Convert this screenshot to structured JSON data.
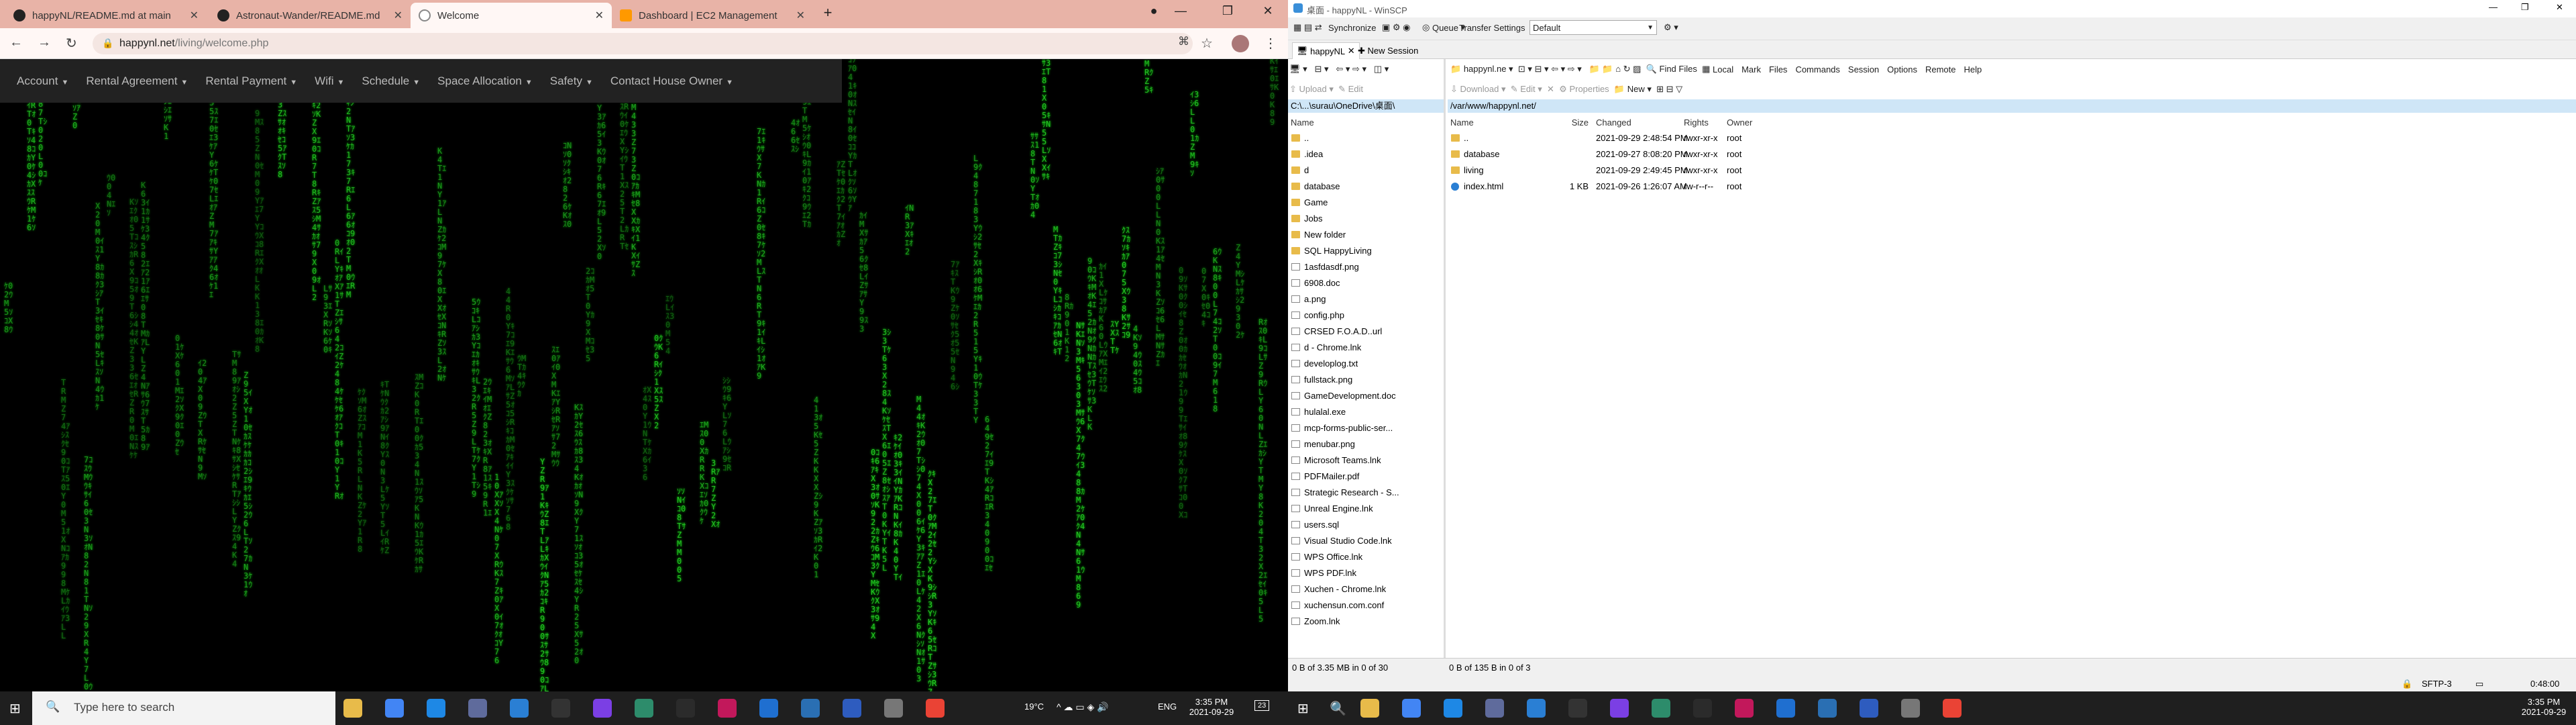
{
  "browser": {
    "tabs": [
      {
        "title": "happyNL/README.md at main"
      },
      {
        "title": "Astronaut-Wander/README.md"
      },
      {
        "title": "Welcome"
      },
      {
        "title": "Dashboard | EC2 Management"
      }
    ],
    "url_host": "happynl.net",
    "url_path": "/living/welcome.php",
    "nav": [
      {
        "label": "Account"
      },
      {
        "label": "Rental Agreement"
      },
      {
        "label": "Rental Payment"
      },
      {
        "label": "Wifi"
      },
      {
        "label": "Schedule"
      },
      {
        "label": "Space Allocation"
      },
      {
        "label": "Safety"
      },
      {
        "label": "Contact House Owner"
      }
    ]
  },
  "winscp": {
    "window_title": "happyNL - WinSCP",
    "title_prefix": "桌面",
    "toolbar1": {
      "synchronize": "Synchronize",
      "queue": "Queue",
      "transfer_settings": "Transfer Settings",
      "transfer_value": "Default"
    },
    "session_tab": "happyNL",
    "new_session": "New Session",
    "left": {
      "path": "C:\\...\\surau\\OneDrive\\桌面\\",
      "upload": "Upload",
      "edit": "Edit",
      "properties": "Properties",
      "new": "New",
      "col_name": "Name",
      "files": [
        {
          "name": "..",
          "type": "up"
        },
        {
          "name": ".idea",
          "type": "folder"
        },
        {
          "name": "d",
          "type": "folder"
        },
        {
          "name": "database",
          "type": "folder"
        },
        {
          "name": "Game",
          "type": "folder"
        },
        {
          "name": "Jobs",
          "type": "folder"
        },
        {
          "name": "New folder",
          "type": "folder"
        },
        {
          "name": "SQL HappyLiving",
          "type": "folder"
        },
        {
          "name": "1asfdasdf.png",
          "type": "file"
        },
        {
          "name": "6908.doc",
          "type": "file"
        },
        {
          "name": "a.png",
          "type": "file"
        },
        {
          "name": "config.php",
          "type": "file"
        },
        {
          "name": "CRSED F.O.A.D..url",
          "type": "file"
        },
        {
          "name": "d - Chrome.lnk",
          "type": "file"
        },
        {
          "name": "developlog.txt",
          "type": "file"
        },
        {
          "name": "fullstack.png",
          "type": "file"
        },
        {
          "name": "GameDevelopment.doc",
          "type": "file"
        },
        {
          "name": "hulalal.exe",
          "type": "file"
        },
        {
          "name": "mcp-forms-public-ser...",
          "type": "file"
        },
        {
          "name": "menubar.png",
          "type": "file"
        },
        {
          "name": "Microsoft Teams.lnk",
          "type": "file"
        },
        {
          "name": "PDFMailer.pdf",
          "type": "file"
        },
        {
          "name": "Strategic Research - S...",
          "type": "file"
        },
        {
          "name": "Unreal Engine.lnk",
          "type": "file"
        },
        {
          "name": "users.sql",
          "type": "file"
        },
        {
          "name": "Visual Studio Code.lnk",
          "type": "file"
        },
        {
          "name": "WPS Office.lnk",
          "type": "file"
        },
        {
          "name": "WPS PDF.lnk",
          "type": "file"
        },
        {
          "name": "Xuchen - Chrome.lnk",
          "type": "file"
        },
        {
          "name": "xuchensun.com.conf",
          "type": "file"
        },
        {
          "name": "Zoom.lnk",
          "type": "file"
        }
      ],
      "status": "0 B of 3.35 MB in 0 of 30"
    },
    "right": {
      "session_combo": "happynl.ne",
      "find_files": "Find Files",
      "menu": [
        "Local",
        "Mark",
        "Files",
        "Commands",
        "Session",
        "Options",
        "Remote",
        "Help"
      ],
      "download": "Download",
      "edit": "Edit",
      "properties": "Properties",
      "new": "New",
      "path": "/var/www/happynl.net/",
      "cols": {
        "name": "Name",
        "size": "Size",
        "changed": "Changed",
        "rights": "Rights",
        "owner": "Owner"
      },
      "files": [
        {
          "name": "..",
          "size": "",
          "changed": "2021-09-29 2:48:54 PM",
          "rights": "rwxr-xr-x",
          "owner": "root",
          "type": "up"
        },
        {
          "name": "database",
          "size": "",
          "changed": "2021-09-27 8:08:20 PM",
          "rights": "rwxr-xr-x",
          "owner": "root",
          "type": "folder"
        },
        {
          "name": "living",
          "size": "",
          "changed": "2021-09-29 2:49:45 PM",
          "rights": "rwxr-xr-x",
          "owner": "root",
          "type": "folder"
        },
        {
          "name": "index.html",
          "size": "1 KB",
          "changed": "2021-09-26 1:26:07 AM",
          "rights": "rw-r--r--",
          "owner": "root",
          "type": "html"
        }
      ],
      "status": "0 B of 135 B in 0 of 3"
    },
    "protocol": "SFTP-3",
    "elapsed": "0:48:00"
  },
  "taskbar": {
    "search_placeholder": "Type here to search",
    "weather": "19°C",
    "lang": "ENG",
    "time": "3:35 PM",
    "date": "2021-09-29",
    "notif_count": "23"
  }
}
